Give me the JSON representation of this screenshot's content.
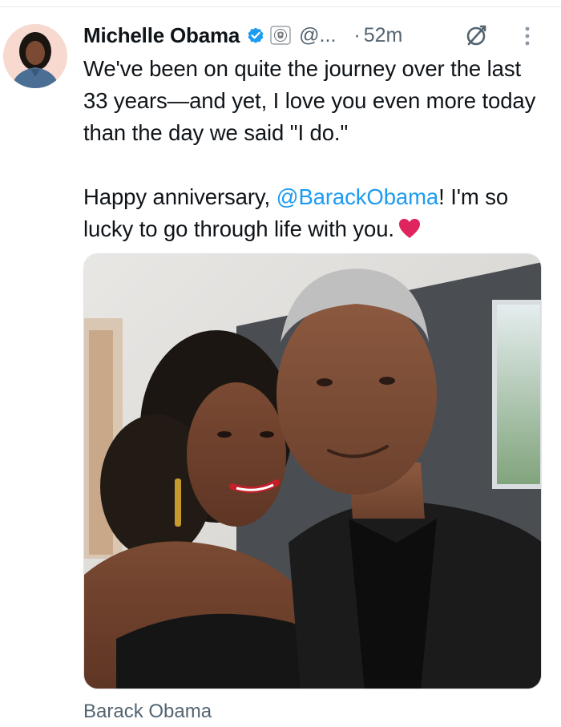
{
  "author": {
    "display_name": "Michelle Obama",
    "handle": "@...",
    "separator": "·",
    "time": "52m",
    "verified": true,
    "avatar_alt": "avatar-icon"
  },
  "tweet": {
    "paragraph1": "We've been on quite the journey over the last 33 years—and yet, I love you even more today than the day we said \"I do.\"",
    "p2_before": "Happy anniversary, ",
    "p2_mention": "@BarackObama",
    "p2_after": "! I'm so lucky to go through life with you.",
    "emoji": "heart-icon"
  },
  "media": {
    "type": "photo",
    "tagged_user": "Barack Obama"
  },
  "colors": {
    "text": "#0f1419",
    "secondary": "#536471",
    "link": "#1d9bf0",
    "verified": "#1d9bf0",
    "heart": "#e0245e"
  }
}
